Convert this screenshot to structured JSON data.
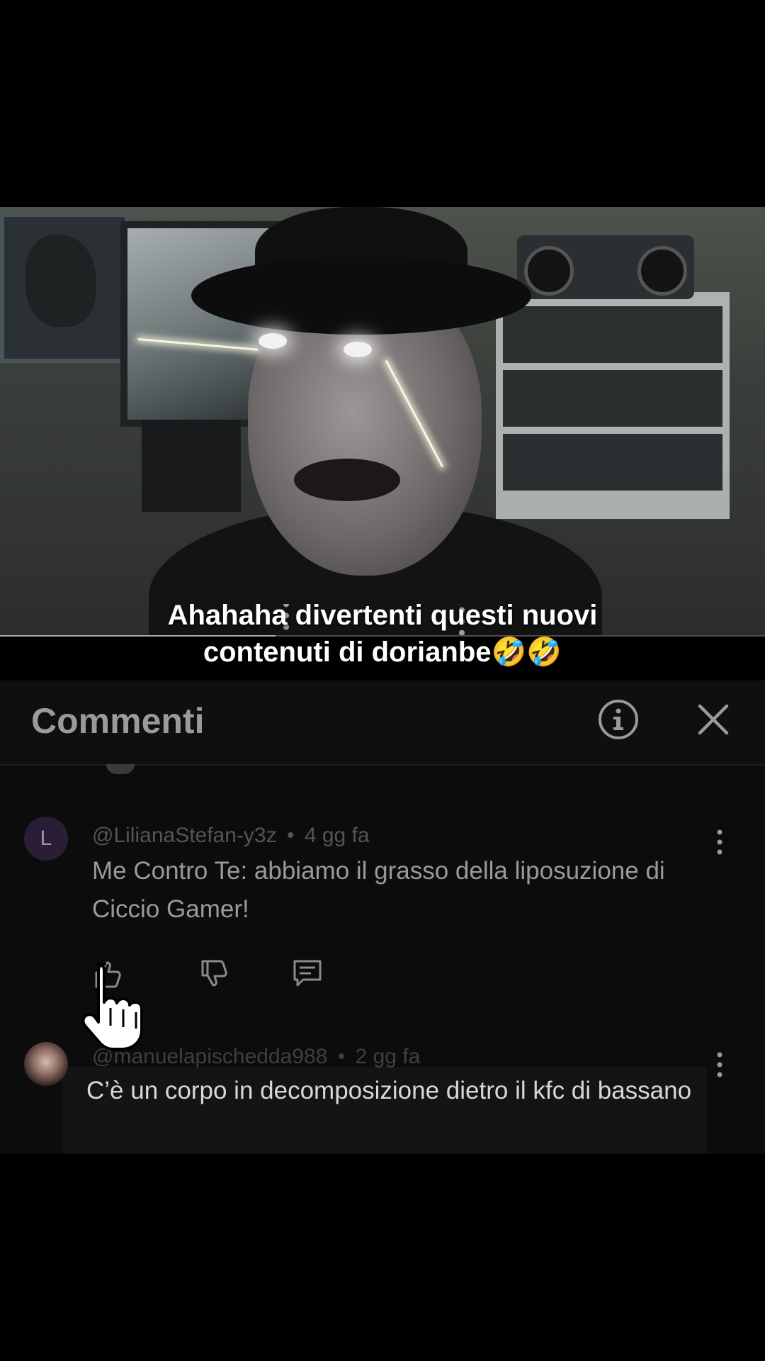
{
  "caption": {
    "line1": "Ahahaha divertenti questi nuovi",
    "line2": "contenuti di dorianbe🤣🤣"
  },
  "video": {
    "progress_fraction": 0.36
  },
  "comments_panel": {
    "title": "Commenti",
    "info_icon": "info-icon",
    "close_icon": "close-icon"
  },
  "comments": [
    {
      "avatar_letter": "L",
      "author": "@LilianaStefan-y3z",
      "separator": "•",
      "time": "4 gg fa",
      "text": "Me Contro Te: abbiamo il grasso della liposuzione di Ciccio Gamer!",
      "actions": [
        "thumbs-up-icon",
        "thumbs-down-icon",
        "reply-icon"
      ]
    },
    {
      "author": "@manuelapischedda988",
      "separator": "•",
      "time": "2 gg fa",
      "text": "C’è un corpo in decomposizione dietro il kfc di bassano"
    }
  ],
  "cursor_icon": "hand-pointer-icon",
  "colors": {
    "background": "#000000",
    "panel": "#0c0c0c",
    "caption_text": "#ffffff",
    "muted_text": "#9a9a9a"
  }
}
